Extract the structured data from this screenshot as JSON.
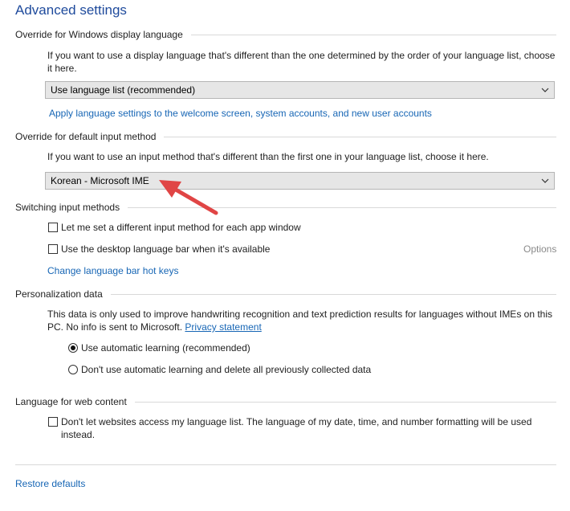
{
  "header": {
    "title": "Advanced settings"
  },
  "display_language": {
    "section_label": "Override for Windows display language",
    "description": "If you want to use a display language that's different than the one determined by the order of your language list, choose it here.",
    "select_value": "Use language list (recommended)",
    "apply_link": "Apply language settings to the welcome screen, system accounts, and new user accounts"
  },
  "input_method": {
    "section_label": "Override for default input method",
    "description": "If you want to use an input method that's different than the first one in your language list, choose it here.",
    "select_value": "Korean - Microsoft IME"
  },
  "switching": {
    "section_label": "Switching input methods",
    "per_app_label": "Let me set a different input method for each app window",
    "per_app_checked": false,
    "language_bar_label": "Use the desktop language bar when it's available",
    "language_bar_checked": false,
    "options_label": "Options",
    "hotkeys_link": "Change language bar hot keys"
  },
  "personalization": {
    "section_label": "Personalization data",
    "description": "This data is only used to improve handwriting recognition and text prediction results for languages without IMEs on this PC. No info is sent to Microsoft.",
    "privacy_link": "Privacy statement",
    "option_auto": "Use automatic learning (recommended)",
    "option_no_auto": "Don't use automatic learning and delete all previously collected data",
    "selected_option": "auto"
  },
  "web_content": {
    "section_label": "Language for web content",
    "checkbox_label": "Don't let websites access my language list. The language of my date, time, and number formatting will be used instead.",
    "checked": false
  },
  "footer": {
    "restore_link": "Restore defaults"
  },
  "colors": {
    "accent": "#1766b5",
    "title": "#1e4a9c",
    "annotation_arrow": "#e04545"
  }
}
